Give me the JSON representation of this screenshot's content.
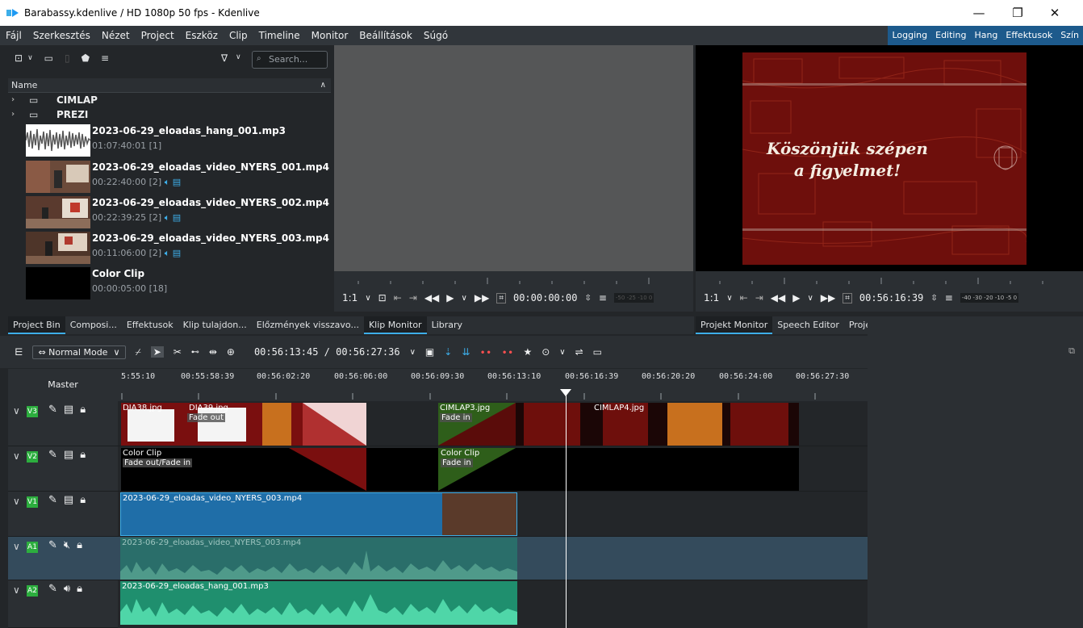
{
  "window": {
    "title": "Barabassy.kdenlive / HD 1080p 50 fps - Kdenlive",
    "minimize": "—",
    "maximize": "❐",
    "close": "✕"
  },
  "menu": [
    "Fájl",
    "Szerkesztés",
    "Nézet",
    "Project",
    "Eszköz",
    "Clip",
    "Timeline",
    "Monitor",
    "Beállítások",
    "Súgó"
  ],
  "layouts": [
    "Logging",
    "Editing",
    "Hang",
    "Effektusok",
    "Szín"
  ],
  "bin": {
    "search_placeholder": "Search...",
    "header": "Name",
    "folders": [
      "CIMLAP",
      "PREZI"
    ],
    "clips": [
      {
        "name": "2023-06-29_eloadas_hang_001.mp3",
        "duration": "01:07:40:01 [1]"
      },
      {
        "name": "2023-06-29_eloadas_video_NYERS_001.mp4",
        "duration": "00:22:40:00 [2]"
      },
      {
        "name": "2023-06-29_eloadas_video_NYERS_002.mp4",
        "duration": "00:22:39:25 [2]"
      },
      {
        "name": "2023-06-29_eloadas_video_NYERS_003.mp4",
        "duration": "00:11:06:00 [2]"
      },
      {
        "name": "Color Clip",
        "duration": "00:00:05:00 [18]"
      }
    ]
  },
  "left_tabs": [
    "Project Bin",
    "Composi...",
    "Effektusok",
    "Klip tulajdon...",
    "Előzmények visszavo...",
    "Klip Monitor",
    "Library"
  ],
  "right_tabs": [
    "Projekt Monitor",
    "Speech Editor",
    "Projekt megjegyzések"
  ],
  "clip_monitor": {
    "zoom": "1:1",
    "timecode": "00:00:00:00",
    "meter": "-50 -25 -10 0"
  },
  "project_monitor": {
    "zoom": "1:1",
    "timecode": "00:56:16:39",
    "slide_text_line1": "Köszönjük szépen",
    "slide_text_line2": "a figyelmet!",
    "meter": "-40 -30  -20  -10 -5 0"
  },
  "timeline": {
    "mode": "Normal Mode",
    "position": "00:56:13:45 / 00:56:27:36",
    "master_label": "Master",
    "ruler": [
      "5:55:10",
      "00:55:58:39",
      "00:56:02:20",
      "00:56:06:00",
      "00:56:09:30",
      "00:56:13:10",
      "00:56:16:39",
      "00:56:20:20",
      "00:56:24:00",
      "00:56:27:30"
    ],
    "tracks": [
      "V3",
      "V2",
      "V1",
      "A1",
      "A2"
    ],
    "clips": {
      "dia38": "DIA38.jpg",
      "dia39": "DIA39.jpg",
      "fade_out": "Fade out",
      "cimlap3": "CIMLAP3.jpg",
      "fade_in": "Fade in",
      "cimlap4": "CIMLAP4.jpg",
      "color_clip": "Color Clip",
      "fade_out_in": "Fade out/Fade in",
      "v1_clip": "2023-06-29_eloadas_video_NYERS_003.mp4",
      "a1_clip": "2023-06-29_eloadas_video_NYERS_003.mp4",
      "a2_clip": "2023-06-29_eloadas_hang_001.mp3"
    }
  }
}
